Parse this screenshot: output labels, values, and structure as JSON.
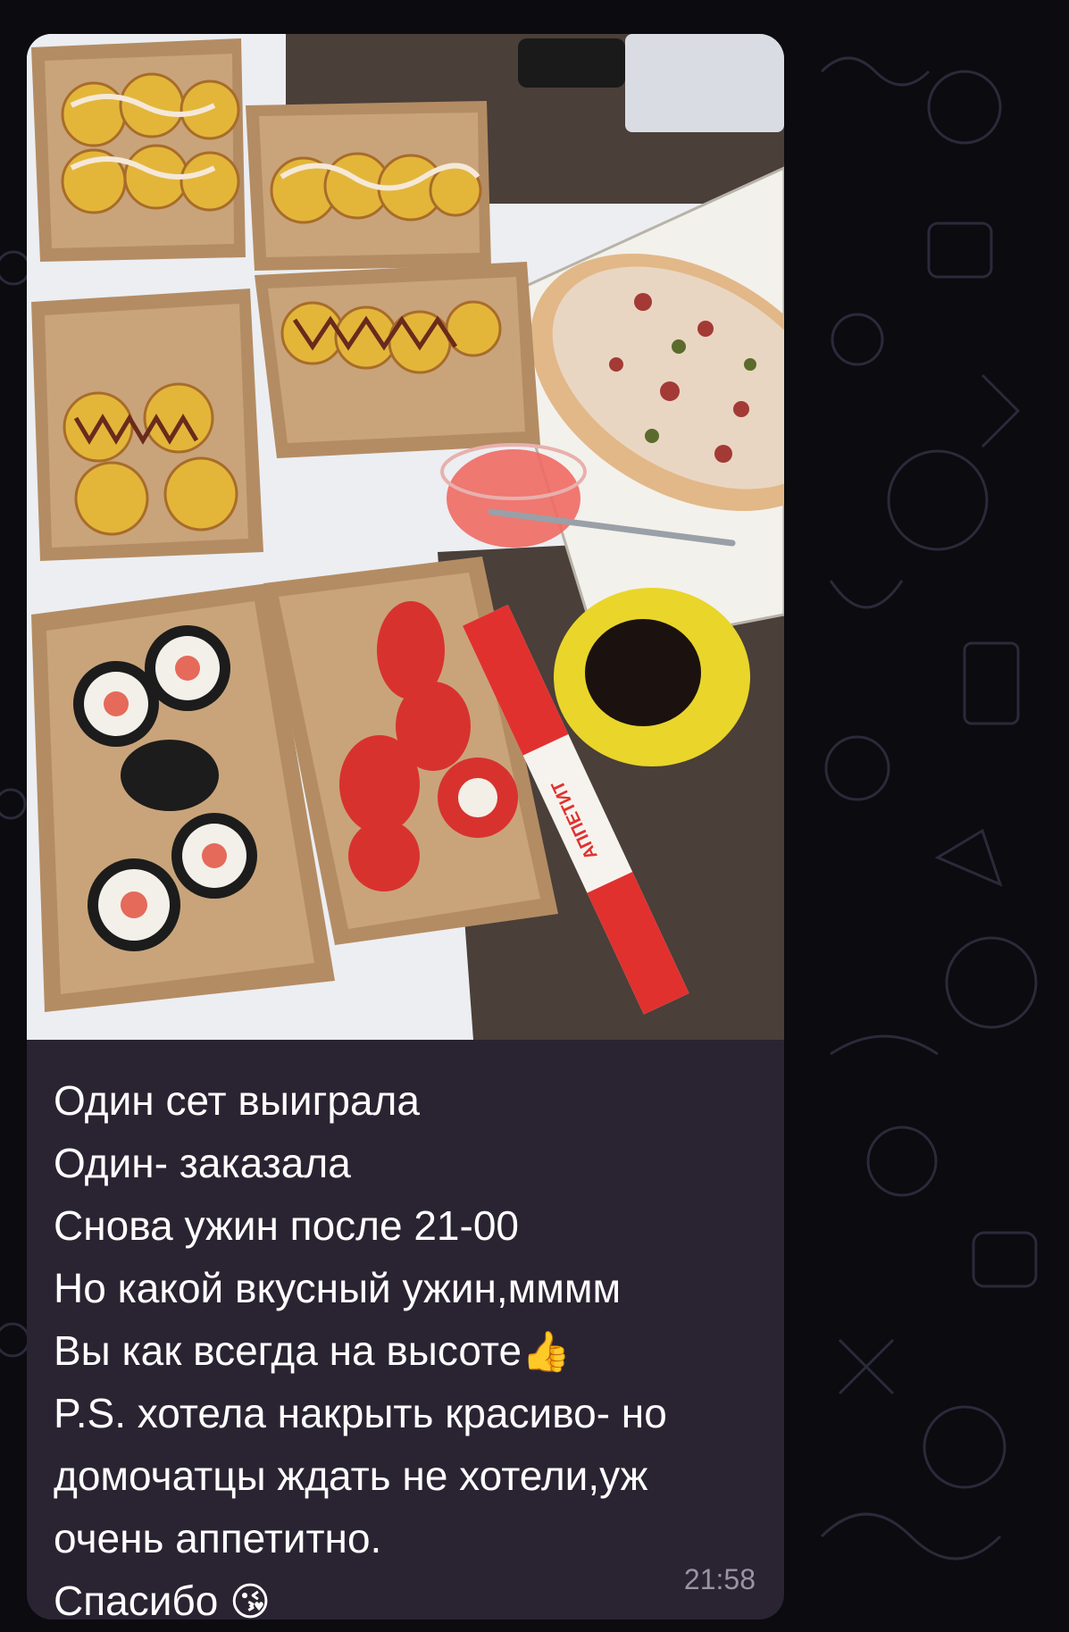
{
  "message": {
    "photo_alt": "Фото ужина: роллы, пицца, соевый соус",
    "chopsticks_brand": "АППЕТИТ",
    "lines": [
      {
        "text": "Один сет выиграла",
        "emoji": ""
      },
      {
        "text": "Один- заказала",
        "emoji": ""
      },
      {
        "text": "Снова ужин после 21-00",
        "emoji": ""
      },
      {
        "text": "Но какой вкусный ужин,мммм",
        "emoji": ""
      },
      {
        "text": "Вы как всегда на высоте",
        "emoji": "👍"
      },
      {
        "text": "P.S. хотела накрыть красиво- но",
        "emoji": ""
      },
      {
        "text": "домочатцы ждать не хотели,уж",
        "emoji": ""
      },
      {
        "text": "очень аппетитно.",
        "emoji": ""
      },
      {
        "text": "Спасибо ",
        "emoji": "😘"
      }
    ],
    "time": "21:58"
  },
  "colors": {
    "background": "#0b0b10",
    "bubble": "#2a2432",
    "text": "#ffffff",
    "time": "#9a93a6"
  }
}
